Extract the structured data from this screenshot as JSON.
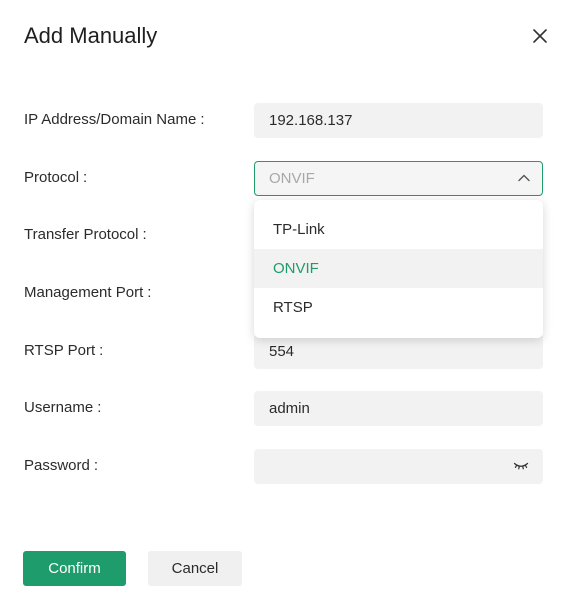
{
  "dialog": {
    "title": "Add Manually",
    "close_icon": "close-icon"
  },
  "fields": {
    "ip": {
      "label": "IP Address/Domain Name",
      "colon": ":",
      "value": "192.168.137"
    },
    "protocol": {
      "label": "Protocol",
      "colon": ":",
      "value": "ONVIF",
      "icon": "chevron-up-icon"
    },
    "transfer_protocol": {
      "label": "Transfer Protocol",
      "colon": ":"
    },
    "management_port": {
      "label": "Management Port",
      "colon": ":"
    },
    "rtsp_port": {
      "label": "RTSP Port",
      "colon": ":",
      "value": "554"
    },
    "username": {
      "label": "Username",
      "colon": ":",
      "value": "admin"
    },
    "password": {
      "label": "Password",
      "colon": ":",
      "value": "",
      "icon": "eye-closed-icon"
    }
  },
  "dropdown": {
    "options": [
      {
        "label": "TP-Link"
      },
      {
        "label": "ONVIF"
      },
      {
        "label": "RTSP"
      }
    ],
    "selected": "ONVIF"
  },
  "buttons": {
    "confirm_label": "Confirm",
    "cancel_label": "Cancel"
  },
  "colors": {
    "accent": "#1f9c6b",
    "field_bg": "#f2f2f2",
    "text": "#2b2b2b"
  }
}
